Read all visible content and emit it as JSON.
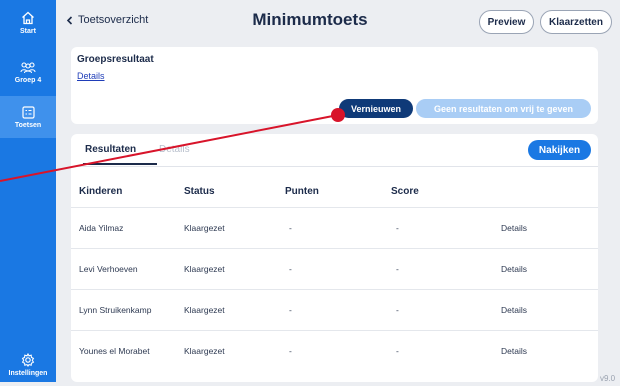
{
  "sidebar": {
    "items": [
      {
        "label": "Start",
        "icon": "home-icon"
      },
      {
        "label": "Groep 4",
        "icon": "group-icon"
      },
      {
        "label": "Toetsen",
        "icon": "test-icon"
      },
      {
        "label": "Instellingen",
        "icon": "gear-icon"
      }
    ],
    "active_index": 2
  },
  "header": {
    "back_label": "Toetsoverzicht",
    "title": "Minimumtoets",
    "preview_label": "Preview",
    "klaarzetten_label": "Klaarzetten"
  },
  "group_card": {
    "title": "Groepsresultaat",
    "details_link": "Details",
    "refresh_label": "Vernieuwen",
    "release_label": "Geen resultaten om vrij te geven"
  },
  "results_card": {
    "tabs": [
      "Resultaten",
      "Details"
    ],
    "active_tab": "Resultaten",
    "grade_label": "Nakijken",
    "columns": [
      "Kinderen",
      "Status",
      "Punten",
      "Score"
    ],
    "rows": [
      {
        "name": "Aida Yilmaz",
        "status": "Klaargezet",
        "points": "-",
        "score": "-",
        "action": "Details"
      },
      {
        "name": "Levi Verhoeven",
        "status": "Klaargezet",
        "points": "-",
        "score": "-",
        "action": "Details"
      },
      {
        "name": "Lynn Struikenkamp",
        "status": "Klaargezet",
        "points": "-",
        "score": "-",
        "action": "Details"
      },
      {
        "name": "Younes el Morabet",
        "status": "Klaargezet",
        "points": "-",
        "score": "-",
        "action": "Details"
      }
    ]
  },
  "version": "v9.0",
  "colors": {
    "sidebar": "#1a78e3",
    "primary_dark": "#0f3a78",
    "disabled": "#a9cdf5",
    "marker": "#d8142a"
  }
}
